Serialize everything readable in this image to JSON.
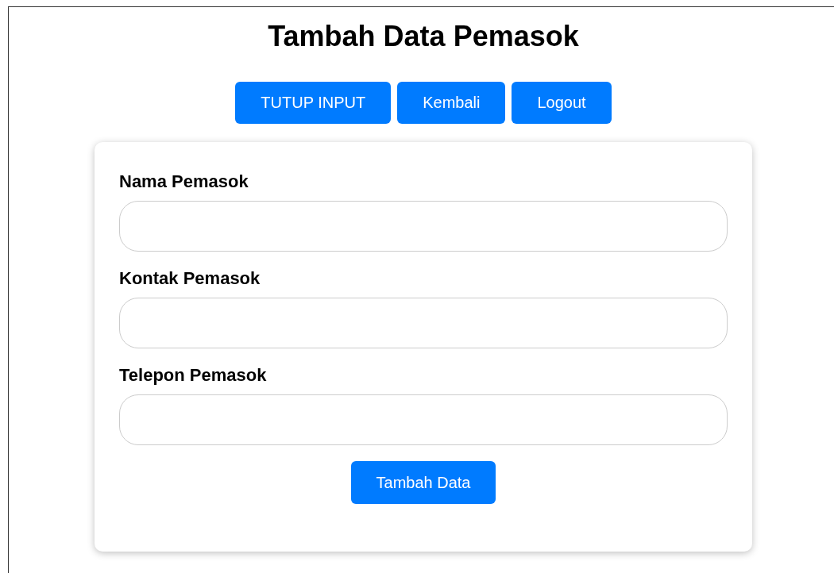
{
  "title": "Tambah Data Pemasok",
  "nav_buttons": [
    {
      "label": "TUTUP INPUT"
    },
    {
      "label": "Kembali"
    },
    {
      "label": "Logout"
    }
  ],
  "form": {
    "fields": [
      {
        "label": "Nama Pemasok"
      },
      {
        "label": "Kontak Pemasok"
      },
      {
        "label": "Telepon Pemasok"
      }
    ],
    "submit": "Tambah Data"
  }
}
